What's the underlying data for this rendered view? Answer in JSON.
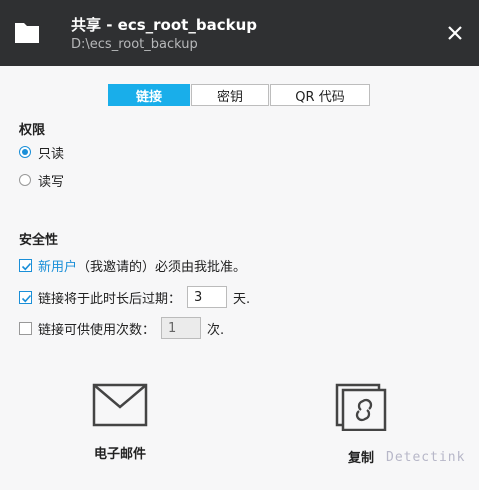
{
  "window": {
    "title": "共享 - ecs_root_backup",
    "path": "D:\\ecs_root_backup"
  },
  "tabs": [
    {
      "label": "链接",
      "active": true
    },
    {
      "label": "密钥",
      "active": false
    },
    {
      "label": "QR 代码",
      "active": false
    }
  ],
  "permissions": {
    "title": "权限",
    "options": [
      {
        "label": "只读",
        "checked": true
      },
      {
        "label": "读写",
        "checked": false
      }
    ]
  },
  "security": {
    "title": "安全性",
    "new_user": {
      "checked": true,
      "link_text": "新用户",
      "rest_text": "（我邀请的）必须由我批准。"
    },
    "expire": {
      "checked": true,
      "label": "链接将于此时长后过期：",
      "value": "3",
      "unit": "天."
    },
    "max_uses": {
      "checked": false,
      "label": "链接可供使用次数：",
      "value": "1",
      "unit": "次."
    }
  },
  "actions": {
    "email": "电子邮件",
    "copy": "复制"
  },
  "watermark": "Detectink",
  "colors": {
    "accent": "#19aeea",
    "title_bar": "#2f3032",
    "checkbox": "#1a8fd8"
  }
}
